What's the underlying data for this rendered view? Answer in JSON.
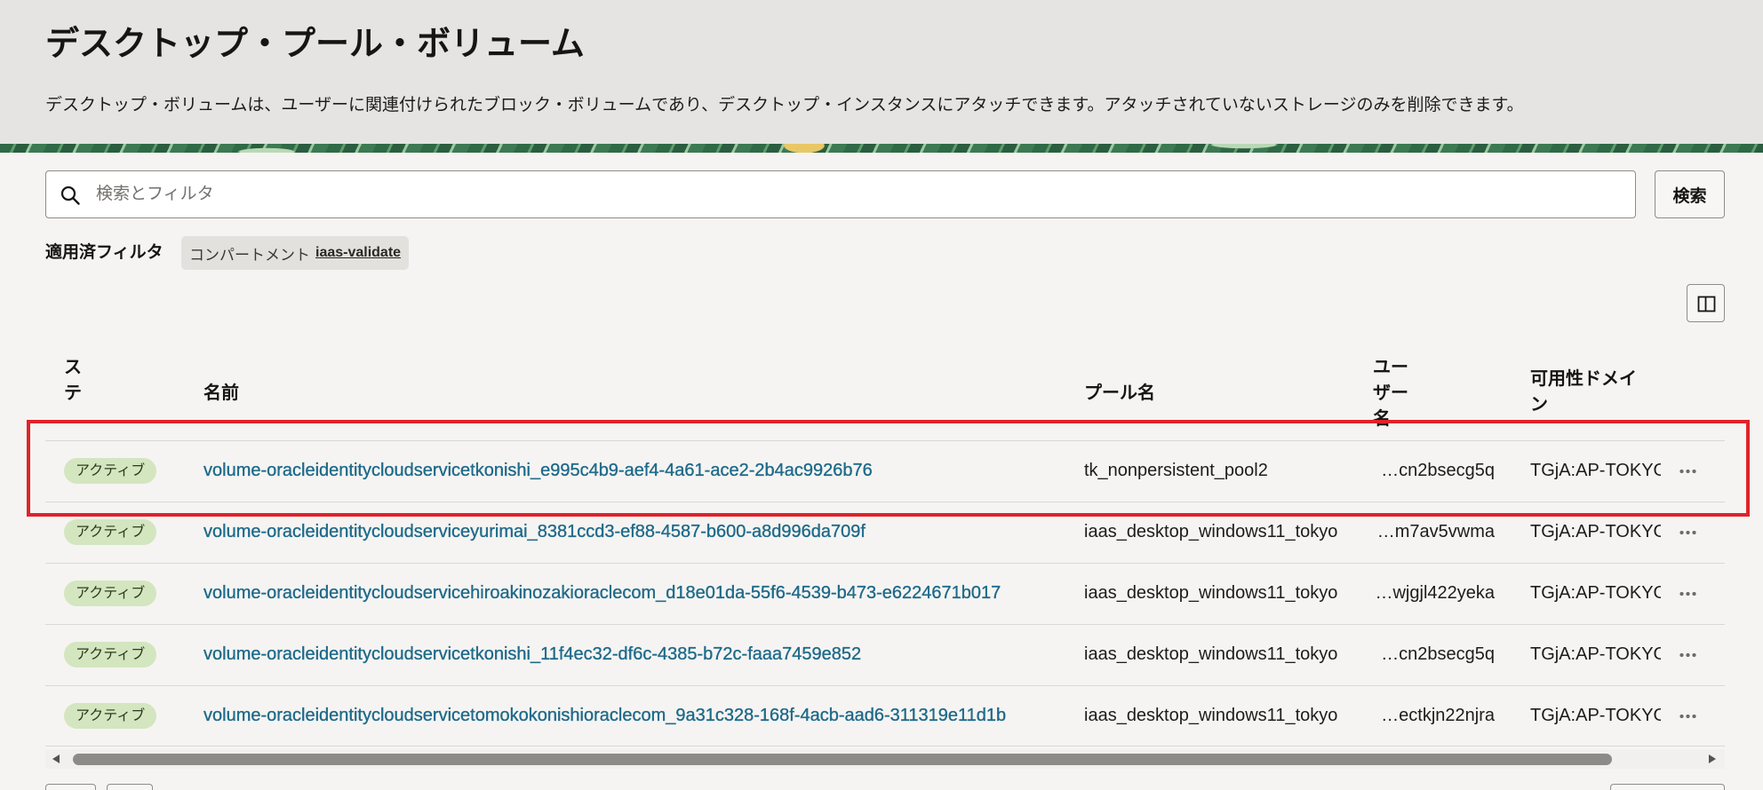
{
  "header": {
    "title": "デスクトップ・プール・ボリューム",
    "description": "デスクトップ・ボリュームは、ユーザーに関連付けられたブロック・ボリュームであり、デスクトップ・インスタンスにアタッチできます。アタッチされていないストレージのみを削除できます。"
  },
  "search": {
    "placeholder": "検索とフィルタ",
    "button_label": "検索",
    "icon": "search-icon"
  },
  "filters": {
    "label": "適用済フィルタ",
    "chips": [
      {
        "key": "コンパートメント",
        "value": "iaas-validate"
      }
    ]
  },
  "toolbar": {
    "column_toggle_icon": "columns-icon"
  },
  "table": {
    "columns": {
      "status": "ステ",
      "name": "名前",
      "pool": "プール名",
      "user": "ユーザー名",
      "domain": "可用性ドメイン"
    },
    "rows": [
      {
        "status": "アクティブ",
        "name": "volume-oracleidentitycloudservicetkonishi_e995c4b9-aef4-4a61-ace2-2b4ac9926b76",
        "pool": "tk_nonpersistent_pool2",
        "user": "…cn2bsecg5q",
        "domain": "TGjA:AP-TOKYO",
        "highlighted": true
      },
      {
        "status": "アクティブ",
        "name": "volume-oracleidentitycloudserviceyurimai_8381ccd3-ef88-4587-b600-a8d996da709f",
        "pool": "iaas_desktop_windows11_tokyo",
        "user": "…m7av5vwma",
        "domain": "TGjA:AP-TOKYO",
        "highlighted": false
      },
      {
        "status": "アクティブ",
        "name": "volume-oracleidentitycloudservicehiroakinozakioraclecom_d18e01da-55f6-4539-b473-e6224671b017",
        "pool": "iaas_desktop_windows11_tokyo",
        "user": "…wjgjl422yeka",
        "domain": "TGjA:AP-TOKYO",
        "highlighted": false
      },
      {
        "status": "アクティブ",
        "name": "volume-oracleidentitycloudservicetkonishi_11f4ec32-df6c-4385-b72c-faaa7459e852",
        "pool": "iaas_desktop_windows11_tokyo",
        "user": "…cn2bsecg5q",
        "domain": "TGjA:AP-TOKYO",
        "highlighted": false
      },
      {
        "status": "アクティブ",
        "name": "volume-oracleidentitycloudservicetomokokonishioraclecom_9a31c328-168f-4acb-aad6-311319e11d1b",
        "pool": "iaas_desktop_windows11_tokyo",
        "user": "…ectkjn22njra",
        "domain": "TGjA:AP-TOKYO",
        "highlighted": false
      }
    ],
    "row_action_icon": "more-actions-icon"
  },
  "colors": {
    "link": "#1f6a8a",
    "status_active_bg": "#d3e6bf",
    "highlight": "#e0232a",
    "header_bg": "#e5e4e2",
    "page_bg": "#f5f4f2"
  }
}
